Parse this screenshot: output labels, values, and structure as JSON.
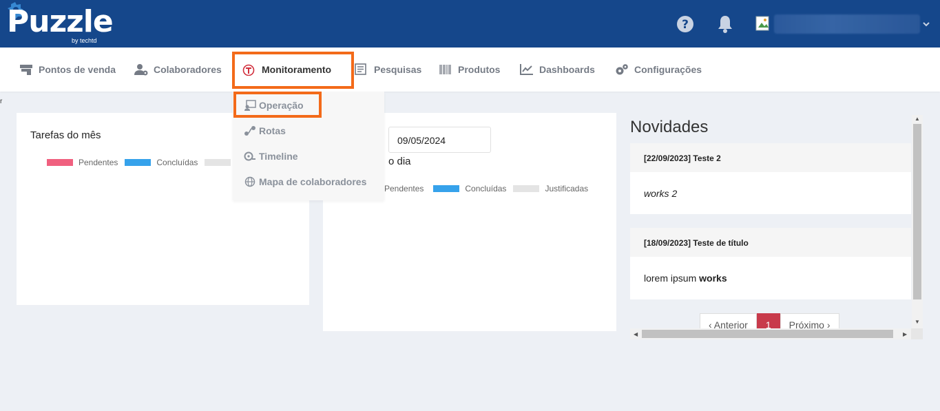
{
  "header": {
    "logo_text": "Puzzle",
    "logo_sub": "by techtd",
    "user_name": ""
  },
  "nav": {
    "items": [
      {
        "label": "Pontos de venda",
        "icon": "store-icon"
      },
      {
        "label": "Colaboradores",
        "icon": "user-gear-icon"
      },
      {
        "label": "Monitoramento",
        "icon": "monitor-logo-icon"
      },
      {
        "label": "Pesquisas",
        "icon": "survey-icon"
      },
      {
        "label": "Produtos",
        "icon": "barcode-icon"
      },
      {
        "label": "Dashboards",
        "icon": "chart-line-icon"
      },
      {
        "label": "Configurações",
        "icon": "gears-icon"
      }
    ],
    "active": "Monitoramento"
  },
  "dropdown": {
    "items": [
      {
        "label": "Operação",
        "icon": "operation-icon"
      },
      {
        "label": "Rotas",
        "icon": "route-icon"
      },
      {
        "label": "Timeline",
        "icon": "timeline-icon"
      },
      {
        "label": "Mapa de colaboradores",
        "icon": "globe-icon"
      }
    ]
  },
  "stray_text": "r",
  "monthly_card": {
    "title": "Tarefas do mês",
    "legend": [
      {
        "label": "Pendentes",
        "color": "#f0607f"
      },
      {
        "label": "Concluídas",
        "color": "#36a2eb"
      },
      {
        "label": "",
        "color": "#e4e4e4"
      }
    ]
  },
  "daily_card": {
    "date_value": "09/05/2024",
    "title_partial": "o dia",
    "legend": [
      {
        "label": "Pendentes",
        "color": "#f0607f"
      },
      {
        "label": "Concluídas",
        "color": "#36a2eb"
      },
      {
        "label": "Justificadas",
        "color": "#e4e4e4"
      }
    ]
  },
  "novidades": {
    "title": "Novidades",
    "posts": [
      {
        "header": "[22/09/2023] Teste 2",
        "body": "works 2"
      },
      {
        "header": "[18/09/2023] Teste de título",
        "body_plain": "lorem ipsum ",
        "body_bold": "works"
      }
    ],
    "pager": {
      "prev": "‹ Anterior",
      "current": "1",
      "next": "Próximo ›"
    }
  },
  "colors": {
    "header_bg": "#15478b",
    "highlight": "#f36a19",
    "page_bg": "#edf0f5"
  }
}
